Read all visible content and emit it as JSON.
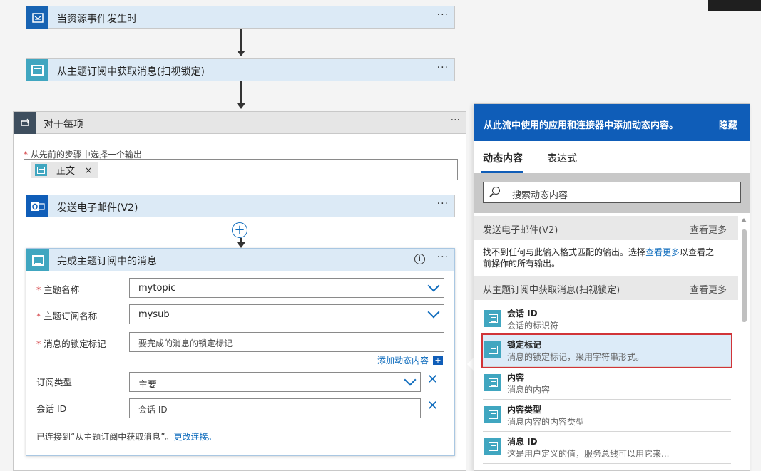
{
  "flow": {
    "trigger_title": "当资源事件发生时",
    "get_messages_title": "从主题订阅中获取消息(扫视锁定)",
    "foreach_title": "对于每项",
    "foreach_label": "从先前的步骤中选择一个输出",
    "foreach_tag": "正文",
    "send_email_title": "发送电子邮件(V2)",
    "complete_title": "完成主题订阅中的消息",
    "more": "···"
  },
  "complete_form": {
    "topic_label": "主题名称",
    "topic_value": "mytopic",
    "subscription_label": "主题订阅名称",
    "subscription_value": "mysub",
    "lock_label": "消息的锁定标记",
    "lock_placeholder": "要完成的消息的锁定标记",
    "add_dynamic": "添加动态内容",
    "subtype_label": "订阅类型",
    "subtype_value": "主要",
    "session_label": "会话 ID",
    "session_placeholder": "会话 ID",
    "connected_text": "已连接到“从主题订阅中获取消息”。",
    "change_connection": "更改连接。"
  },
  "panel": {
    "header_msg": "从此流中使用的应用和连接器中添加动态内容。",
    "hide": "隐藏",
    "tabs": [
      "动态内容",
      "表达式"
    ],
    "search_placeholder": "搜索动态内容",
    "section1_title": "发送电子邮件(V2)",
    "see_more": "查看更多",
    "note_pre": "找不到任何与此输入格式匹配的输出。选择",
    "note_link": "查看更多",
    "note_post": "以查看之前操作的所有输出。",
    "section2_title": "从主题订阅中获取消息(扫视锁定)",
    "items": [
      {
        "name": "会话 ID",
        "desc": "会话的标识符"
      },
      {
        "name": "锁定标记",
        "desc": "消息的锁定标记，采用字符串形式。"
      },
      {
        "name": "内容",
        "desc": "消息的内容"
      },
      {
        "name": "内容类型",
        "desc": "消息内容的内容类型"
      },
      {
        "name": "消息 ID",
        "desc": "这是用户定义的值，服务总线可以用它来..."
      }
    ]
  },
  "colors": {
    "accent": "#0f5db8",
    "servicebus": "#40a6c0",
    "highlight": "#d13438"
  }
}
